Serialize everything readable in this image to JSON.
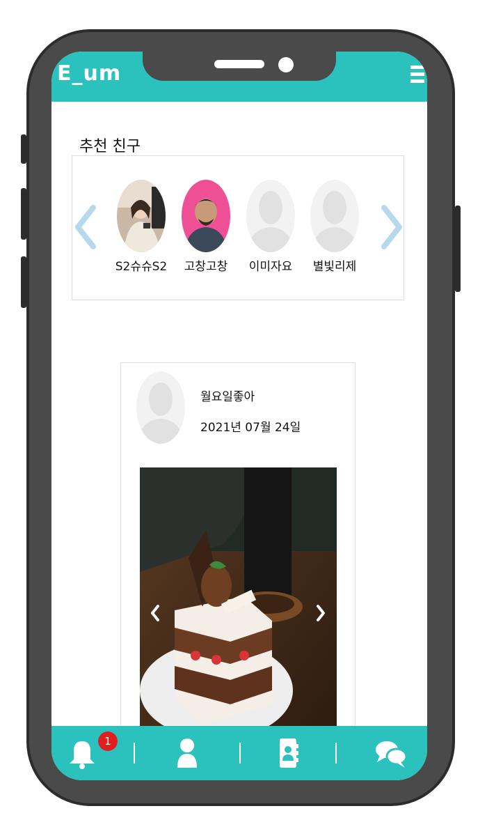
{
  "app": {
    "logo": "E_um"
  },
  "recommend": {
    "title": "추천 친구",
    "friends": [
      {
        "name": "S2슈슈S2"
      },
      {
        "name": "고창고창"
      },
      {
        "name": "이미자요"
      },
      {
        "name": "별빛리제"
      }
    ]
  },
  "post": {
    "username": "월요일좋아",
    "date": "2021년 07월 24일"
  },
  "bottom_nav": {
    "notification_count": "1",
    "items": [
      {
        "icon": "bell-icon"
      },
      {
        "icon": "person-icon"
      },
      {
        "icon": "contact-book-icon"
      },
      {
        "icon": "chat-bubbles-icon"
      }
    ]
  },
  "colors": {
    "accent": "#2bc1bd",
    "badge": "#e02020",
    "arrow": "#b7d9ee"
  }
}
